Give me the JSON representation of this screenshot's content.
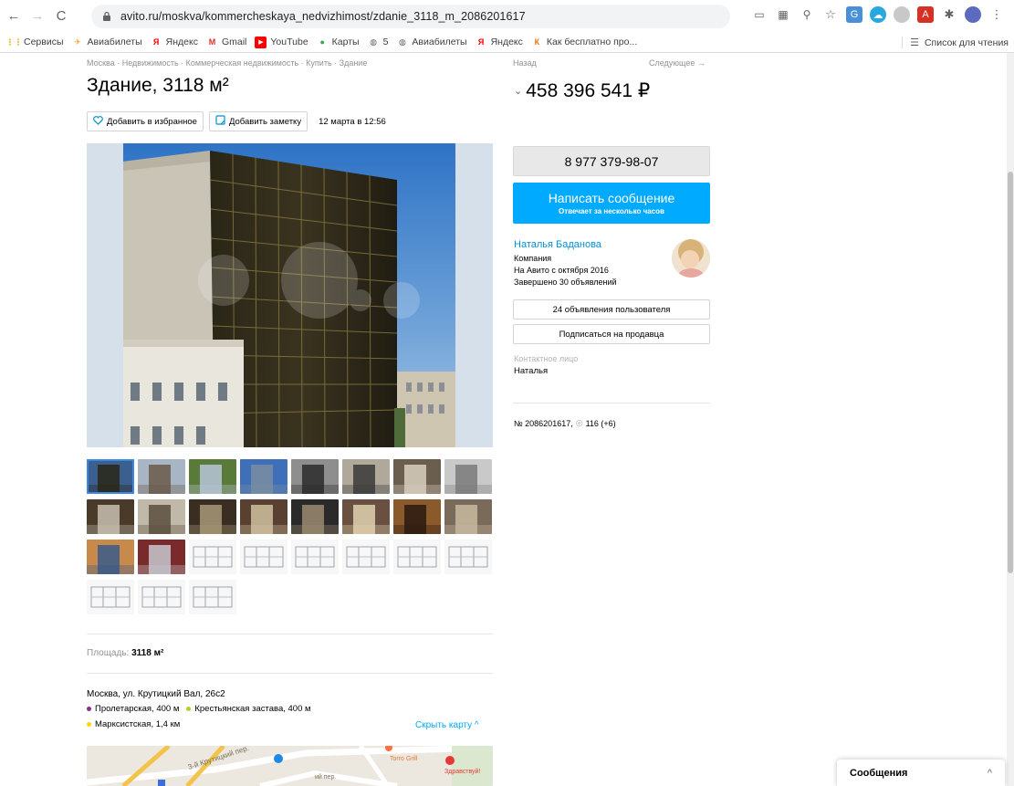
{
  "browser": {
    "url": "avito.ru/moskva/kommercheskaya_nedvizhimost/zdanie_3118_m_2086201617",
    "bookmarks": [
      {
        "label": "Сервисы",
        "icon": "apps-grid-icon",
        "color": "#f4b400"
      },
      {
        "label": "Авиабилеты",
        "icon": "plane-icon",
        "color": "#f5a623"
      },
      {
        "label": "Яндекс",
        "icon": "yandex-icon",
        "color": "#ff0000"
      },
      {
        "label": "Gmail",
        "icon": "gmail-icon",
        "color": "#d93025"
      },
      {
        "label": "YouTube",
        "icon": "youtube-icon",
        "color": "#ff0000"
      },
      {
        "label": "Карты",
        "icon": "maps-pin-icon",
        "color": "#34a853"
      },
      {
        "label": "5",
        "icon": "globe-icon",
        "color": "#5f6368"
      },
      {
        "label": "Авиабилеты",
        "icon": "globe-icon",
        "color": "#5f6368"
      },
      {
        "label": "Яндекс",
        "icon": "yandex-icon",
        "color": "#ff0000"
      },
      {
        "label": "Как бесплатно про...",
        "icon": "article-icon",
        "color": "#e8710a"
      }
    ],
    "reading_list": "Список для чтения"
  },
  "listing": {
    "breadcrumbs": "Москва · Недвижимость · Коммерческая недвижимость · Купить · Здание",
    "title": "Здание, 3118 м²",
    "add_favorite": "Добавить в избранное",
    "add_note": "Добавить заметку",
    "date": "12 марта в 12:56",
    "area_label": "Площадь:",
    "area_value": "3118 м²",
    "address": "Москва, ул. Крутицкий Вал, 26с2",
    "metro": [
      {
        "name": "Пролетарская, 400 м",
        "color": "#8b2e8b"
      },
      {
        "name": "Крестьянская застава, 400 м",
        "color": "#b5cf2a"
      },
      {
        "name": "Марксистская, 1,4 км",
        "color": "#ffd600"
      }
    ],
    "hide_map": "Скрыть карту ^",
    "map_labels": {
      "street1": "3-й Крутицкий пер.",
      "street2": "ий пер.",
      "poi1": "Torro Grill",
      "poi2": "Здравствуй!"
    }
  },
  "sidebar": {
    "back": "Назад",
    "next": "Следующее →",
    "price": "458 396 541 ₽",
    "phone": "8 977 379-98-07",
    "message_button": "Написать сообщение",
    "message_sub": "Отвечает за несколько часов",
    "seller_name": "Наталья Баданова",
    "seller_type": "Компания",
    "seller_since": "На Авито с октября 2016",
    "seller_done": "Завершено 30 объявлений",
    "user_ads": "24 объявления пользователя",
    "subscribe": "Подписаться на продавца",
    "contact_label": "Контактное лицо",
    "contact_name": "Наталья",
    "ad_number": "№ 2086201617,",
    "views": "116 (+6)"
  },
  "messages_panel": {
    "label": "Сообщения"
  },
  "colors": {
    "accent": "#00aaff",
    "link": "#0091d9",
    "selected_thumb": "#3b87e4"
  }
}
